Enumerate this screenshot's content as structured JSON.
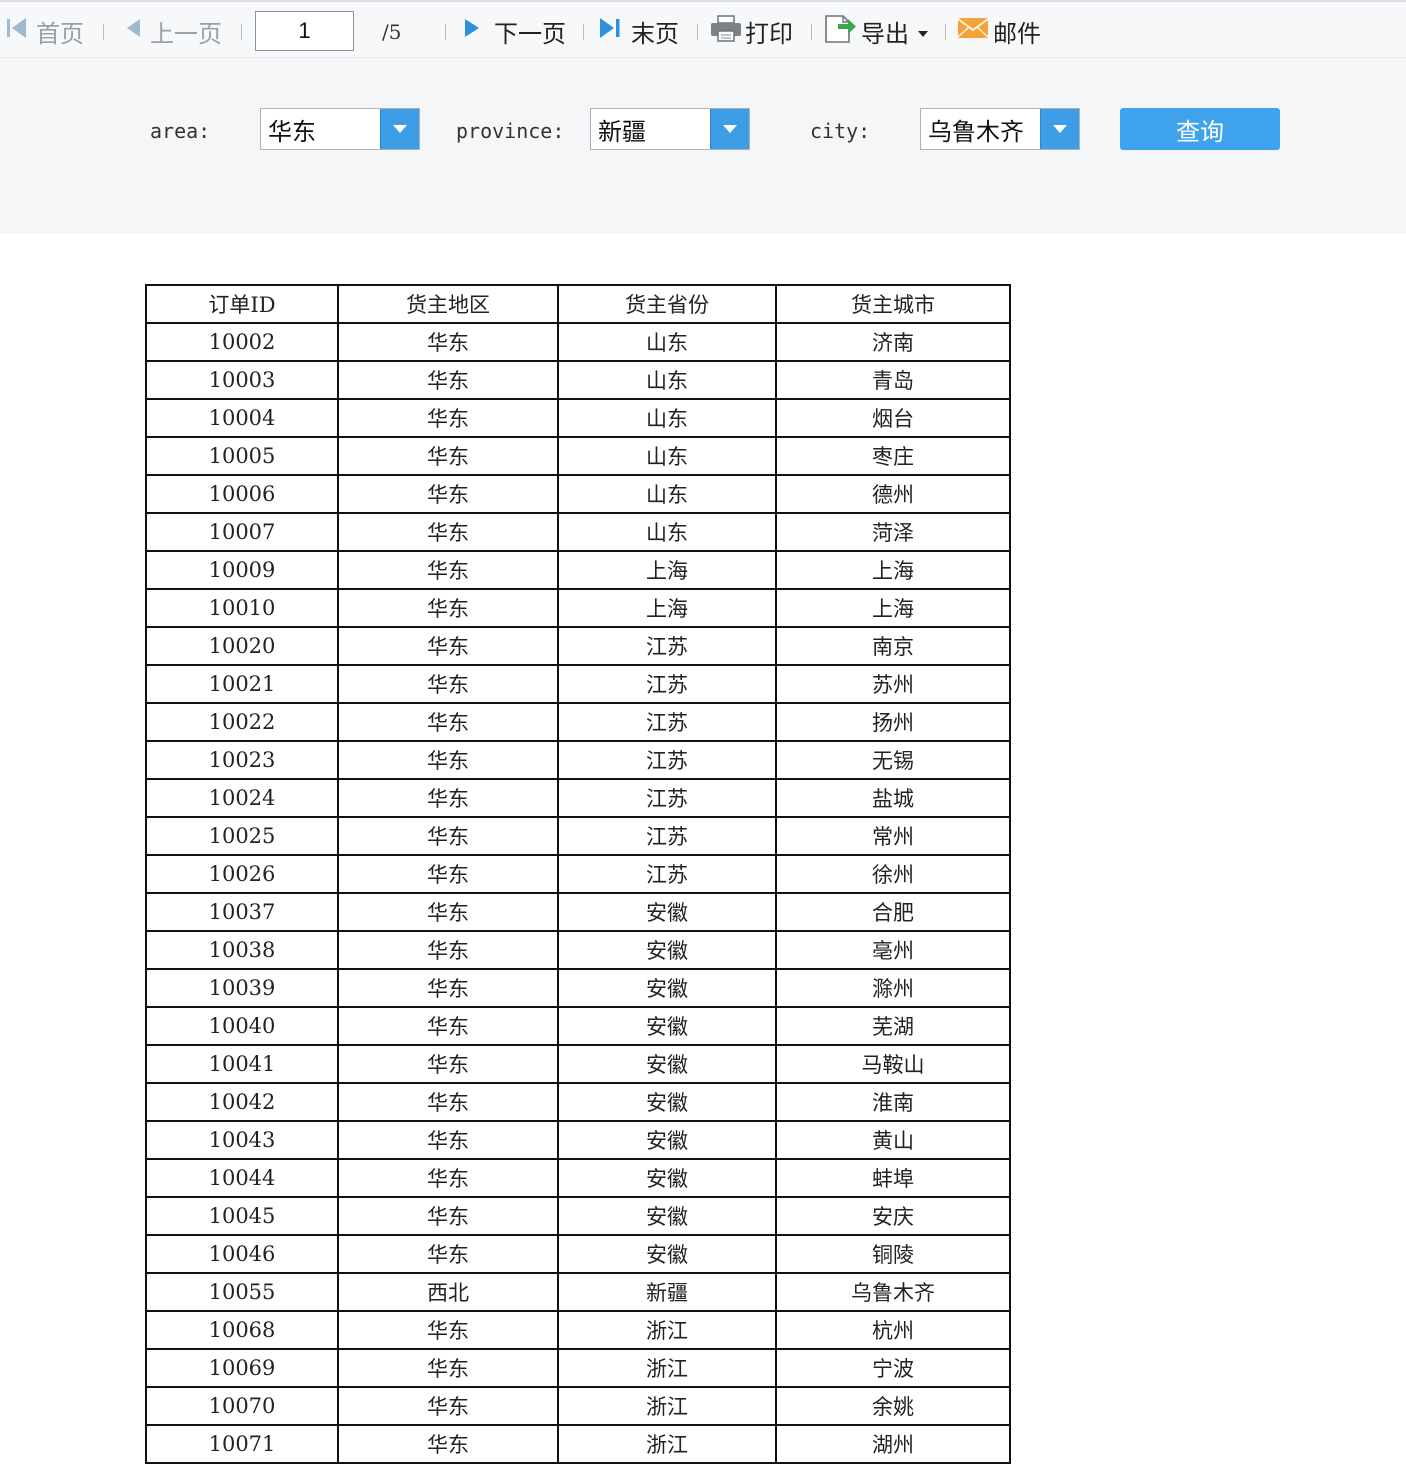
{
  "toolbar": {
    "first_label": "首页",
    "prev_label": "上一页",
    "current_page": "1",
    "total_pages": "/5",
    "next_label": "下一页",
    "last_label": "末页",
    "print_label": "打印",
    "export_label": "导出",
    "email_label": "邮件"
  },
  "filters": {
    "area_label": "area:",
    "area_value": "华东",
    "province_label": "province:",
    "province_value": "新疆",
    "city_label": "city:",
    "city_value": "乌鲁木齐",
    "query_label": "查询"
  },
  "table": {
    "headers": [
      "订单ID",
      "货主地区",
      "货主省份",
      "货主城市"
    ],
    "rows": [
      [
        "10002",
        "华东",
        "山东",
        "济南"
      ],
      [
        "10003",
        "华东",
        "山东",
        "青岛"
      ],
      [
        "10004",
        "华东",
        "山东",
        "烟台"
      ],
      [
        "10005",
        "华东",
        "山东",
        "枣庄"
      ],
      [
        "10006",
        "华东",
        "山东",
        "德州"
      ],
      [
        "10007",
        "华东",
        "山东",
        "菏泽"
      ],
      [
        "10009",
        "华东",
        "上海",
        "上海"
      ],
      [
        "10010",
        "华东",
        "上海",
        "上海"
      ],
      [
        "10020",
        "华东",
        "江苏",
        "南京"
      ],
      [
        "10021",
        "华东",
        "江苏",
        "苏州"
      ],
      [
        "10022",
        "华东",
        "江苏",
        "扬州"
      ],
      [
        "10023",
        "华东",
        "江苏",
        "无锡"
      ],
      [
        "10024",
        "华东",
        "江苏",
        "盐城"
      ],
      [
        "10025",
        "华东",
        "江苏",
        "常州"
      ],
      [
        "10026",
        "华东",
        "江苏",
        "徐州"
      ],
      [
        "10037",
        "华东",
        "安徽",
        "合肥"
      ],
      [
        "10038",
        "华东",
        "安徽",
        "亳州"
      ],
      [
        "10039",
        "华东",
        "安徽",
        "滁州"
      ],
      [
        "10040",
        "华东",
        "安徽",
        "芜湖"
      ],
      [
        "10041",
        "华东",
        "安徽",
        "马鞍山"
      ],
      [
        "10042",
        "华东",
        "安徽",
        "淮南"
      ],
      [
        "10043",
        "华东",
        "安徽",
        "黄山"
      ],
      [
        "10044",
        "华东",
        "安徽",
        "蚌埠"
      ],
      [
        "10045",
        "华东",
        "安徽",
        "安庆"
      ],
      [
        "10046",
        "华东",
        "安徽",
        "铜陵"
      ],
      [
        "10055",
        "西北",
        "新疆",
        "乌鲁木齐"
      ],
      [
        "10068",
        "华东",
        "浙江",
        "杭州"
      ],
      [
        "10069",
        "华东",
        "浙江",
        "宁波"
      ],
      [
        "10070",
        "华东",
        "浙江",
        "余姚"
      ],
      [
        "10071",
        "华东",
        "浙江",
        "湖州"
      ]
    ]
  },
  "colors": {
    "accent": "#3fa2ec",
    "icon_blue": "#2f8fd8",
    "icon_disabled": "#9fb9cf",
    "email_orange": "#f3a33a",
    "export_green": "#3aa84a"
  },
  "icons": {
    "first": "first-page-icon",
    "prev": "prev-page-icon",
    "next": "next-page-icon",
    "last": "last-page-icon",
    "print": "printer-icon",
    "export": "export-icon",
    "export_caret": "caret-down-icon",
    "email": "envelope-icon",
    "dropdown": "dropdown-arrow-icon"
  }
}
